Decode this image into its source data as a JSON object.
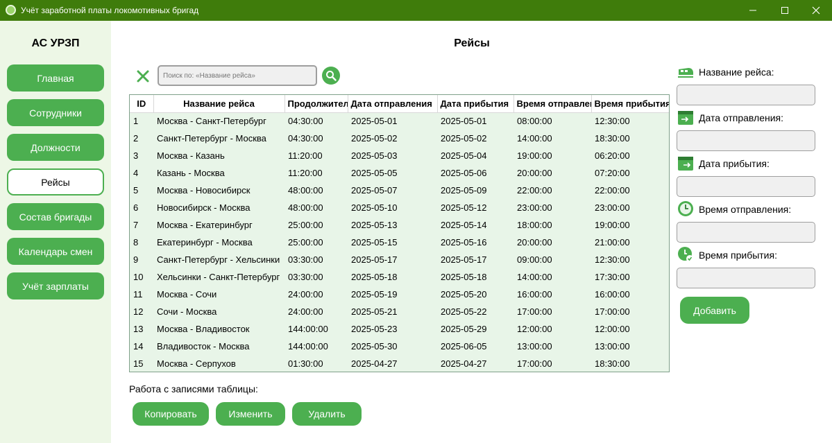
{
  "window": {
    "title": "Учёт заработной платы локомотивных бригад",
    "accent": "#3f7c0b",
    "button_green": "#4caf50"
  },
  "sidebar": {
    "brand": "АС УРЗП",
    "items": [
      {
        "label": "Главная"
      },
      {
        "label": "Сотрудники"
      },
      {
        "label": "Должности"
      },
      {
        "label": "Рейсы",
        "active": true
      },
      {
        "label": "Состав бригады"
      },
      {
        "label": "Календарь смен"
      },
      {
        "label": "Учёт зарплаты"
      }
    ]
  },
  "main": {
    "title": "Рейсы",
    "search": {
      "placeholder": "Поиск по: «Название рейса»",
      "value": ""
    },
    "table": {
      "columns": [
        "ID",
        "Название рейса",
        "Продолжительность",
        "Дата отправления",
        "Дата прибытия",
        "Время отправления",
        "Время прибытия"
      ],
      "rows": [
        [
          "1",
          "Москва - Санкт-Петербург",
          "04:30:00",
          "2025-05-01",
          "2025-05-01",
          "08:00:00",
          "12:30:00"
        ],
        [
          "2",
          "Санкт-Петербург - Москва",
          "04:30:00",
          "2025-05-02",
          "2025-05-02",
          "14:00:00",
          "18:30:00"
        ],
        [
          "3",
          "Москва - Казань",
          "11:20:00",
          "2025-05-03",
          "2025-05-04",
          "19:00:00",
          "06:20:00"
        ],
        [
          "4",
          "Казань - Москва",
          "11:20:00",
          "2025-05-05",
          "2025-05-06",
          "20:00:00",
          "07:20:00"
        ],
        [
          "5",
          "Москва - Новосибирск",
          "48:00:00",
          "2025-05-07",
          "2025-05-09",
          "22:00:00",
          "22:00:00"
        ],
        [
          "6",
          "Новосибирск - Москва",
          "48:00:00",
          "2025-05-10",
          "2025-05-12",
          "23:00:00",
          "23:00:00"
        ],
        [
          "7",
          "Москва - Екатеринбург",
          "25:00:00",
          "2025-05-13",
          "2025-05-14",
          "18:00:00",
          "19:00:00"
        ],
        [
          "8",
          "Екатеринбург - Москва",
          "25:00:00",
          "2025-05-15",
          "2025-05-16",
          "20:00:00",
          "21:00:00"
        ],
        [
          "9",
          "Санкт-Петербург - Хельсинки",
          "03:30:00",
          "2025-05-17",
          "2025-05-17",
          "09:00:00",
          "12:30:00"
        ],
        [
          "10",
          "Хельсинки - Санкт-Петербург",
          "03:30:00",
          "2025-05-18",
          "2025-05-18",
          "14:00:00",
          "17:30:00"
        ],
        [
          "11",
          "Москва - Сочи",
          "24:00:00",
          "2025-05-19",
          "2025-05-20",
          "16:00:00",
          "16:00:00"
        ],
        [
          "12",
          "Сочи - Москва",
          "24:00:00",
          "2025-05-21",
          "2025-05-22",
          "17:00:00",
          "17:00:00"
        ],
        [
          "13",
          "Москва - Владивосток",
          "144:00:00",
          "2025-05-23",
          "2025-05-29",
          "12:00:00",
          "12:00:00"
        ],
        [
          "14",
          "Владивосток - Москва",
          "144:00:00",
          "2025-05-30",
          "2025-06-05",
          "13:00:00",
          "13:00:00"
        ],
        [
          "15",
          "Москва - Серпухов",
          "01:30:00",
          "2025-04-27",
          "2025-04-27",
          "17:00:00",
          "18:30:00"
        ]
      ]
    },
    "records_label": "Работа с записями таблицы:",
    "actions": {
      "copy": "Копировать",
      "edit": "Изменить",
      "delete": "Удалить"
    }
  },
  "form": {
    "fields": [
      {
        "label": "Название рейса:",
        "icon": "train-icon",
        "value": ""
      },
      {
        "label": "Дата отправления:",
        "icon": "calendar-departure-icon",
        "value": ""
      },
      {
        "label": "Дата прибытия:",
        "icon": "calendar-arrival-icon",
        "value": ""
      },
      {
        "label": "Время отправления:",
        "icon": "clock-icon",
        "value": ""
      },
      {
        "label": "Время прибытия:",
        "icon": "clock-check-icon",
        "value": ""
      }
    ],
    "add_label": "Добавить"
  }
}
